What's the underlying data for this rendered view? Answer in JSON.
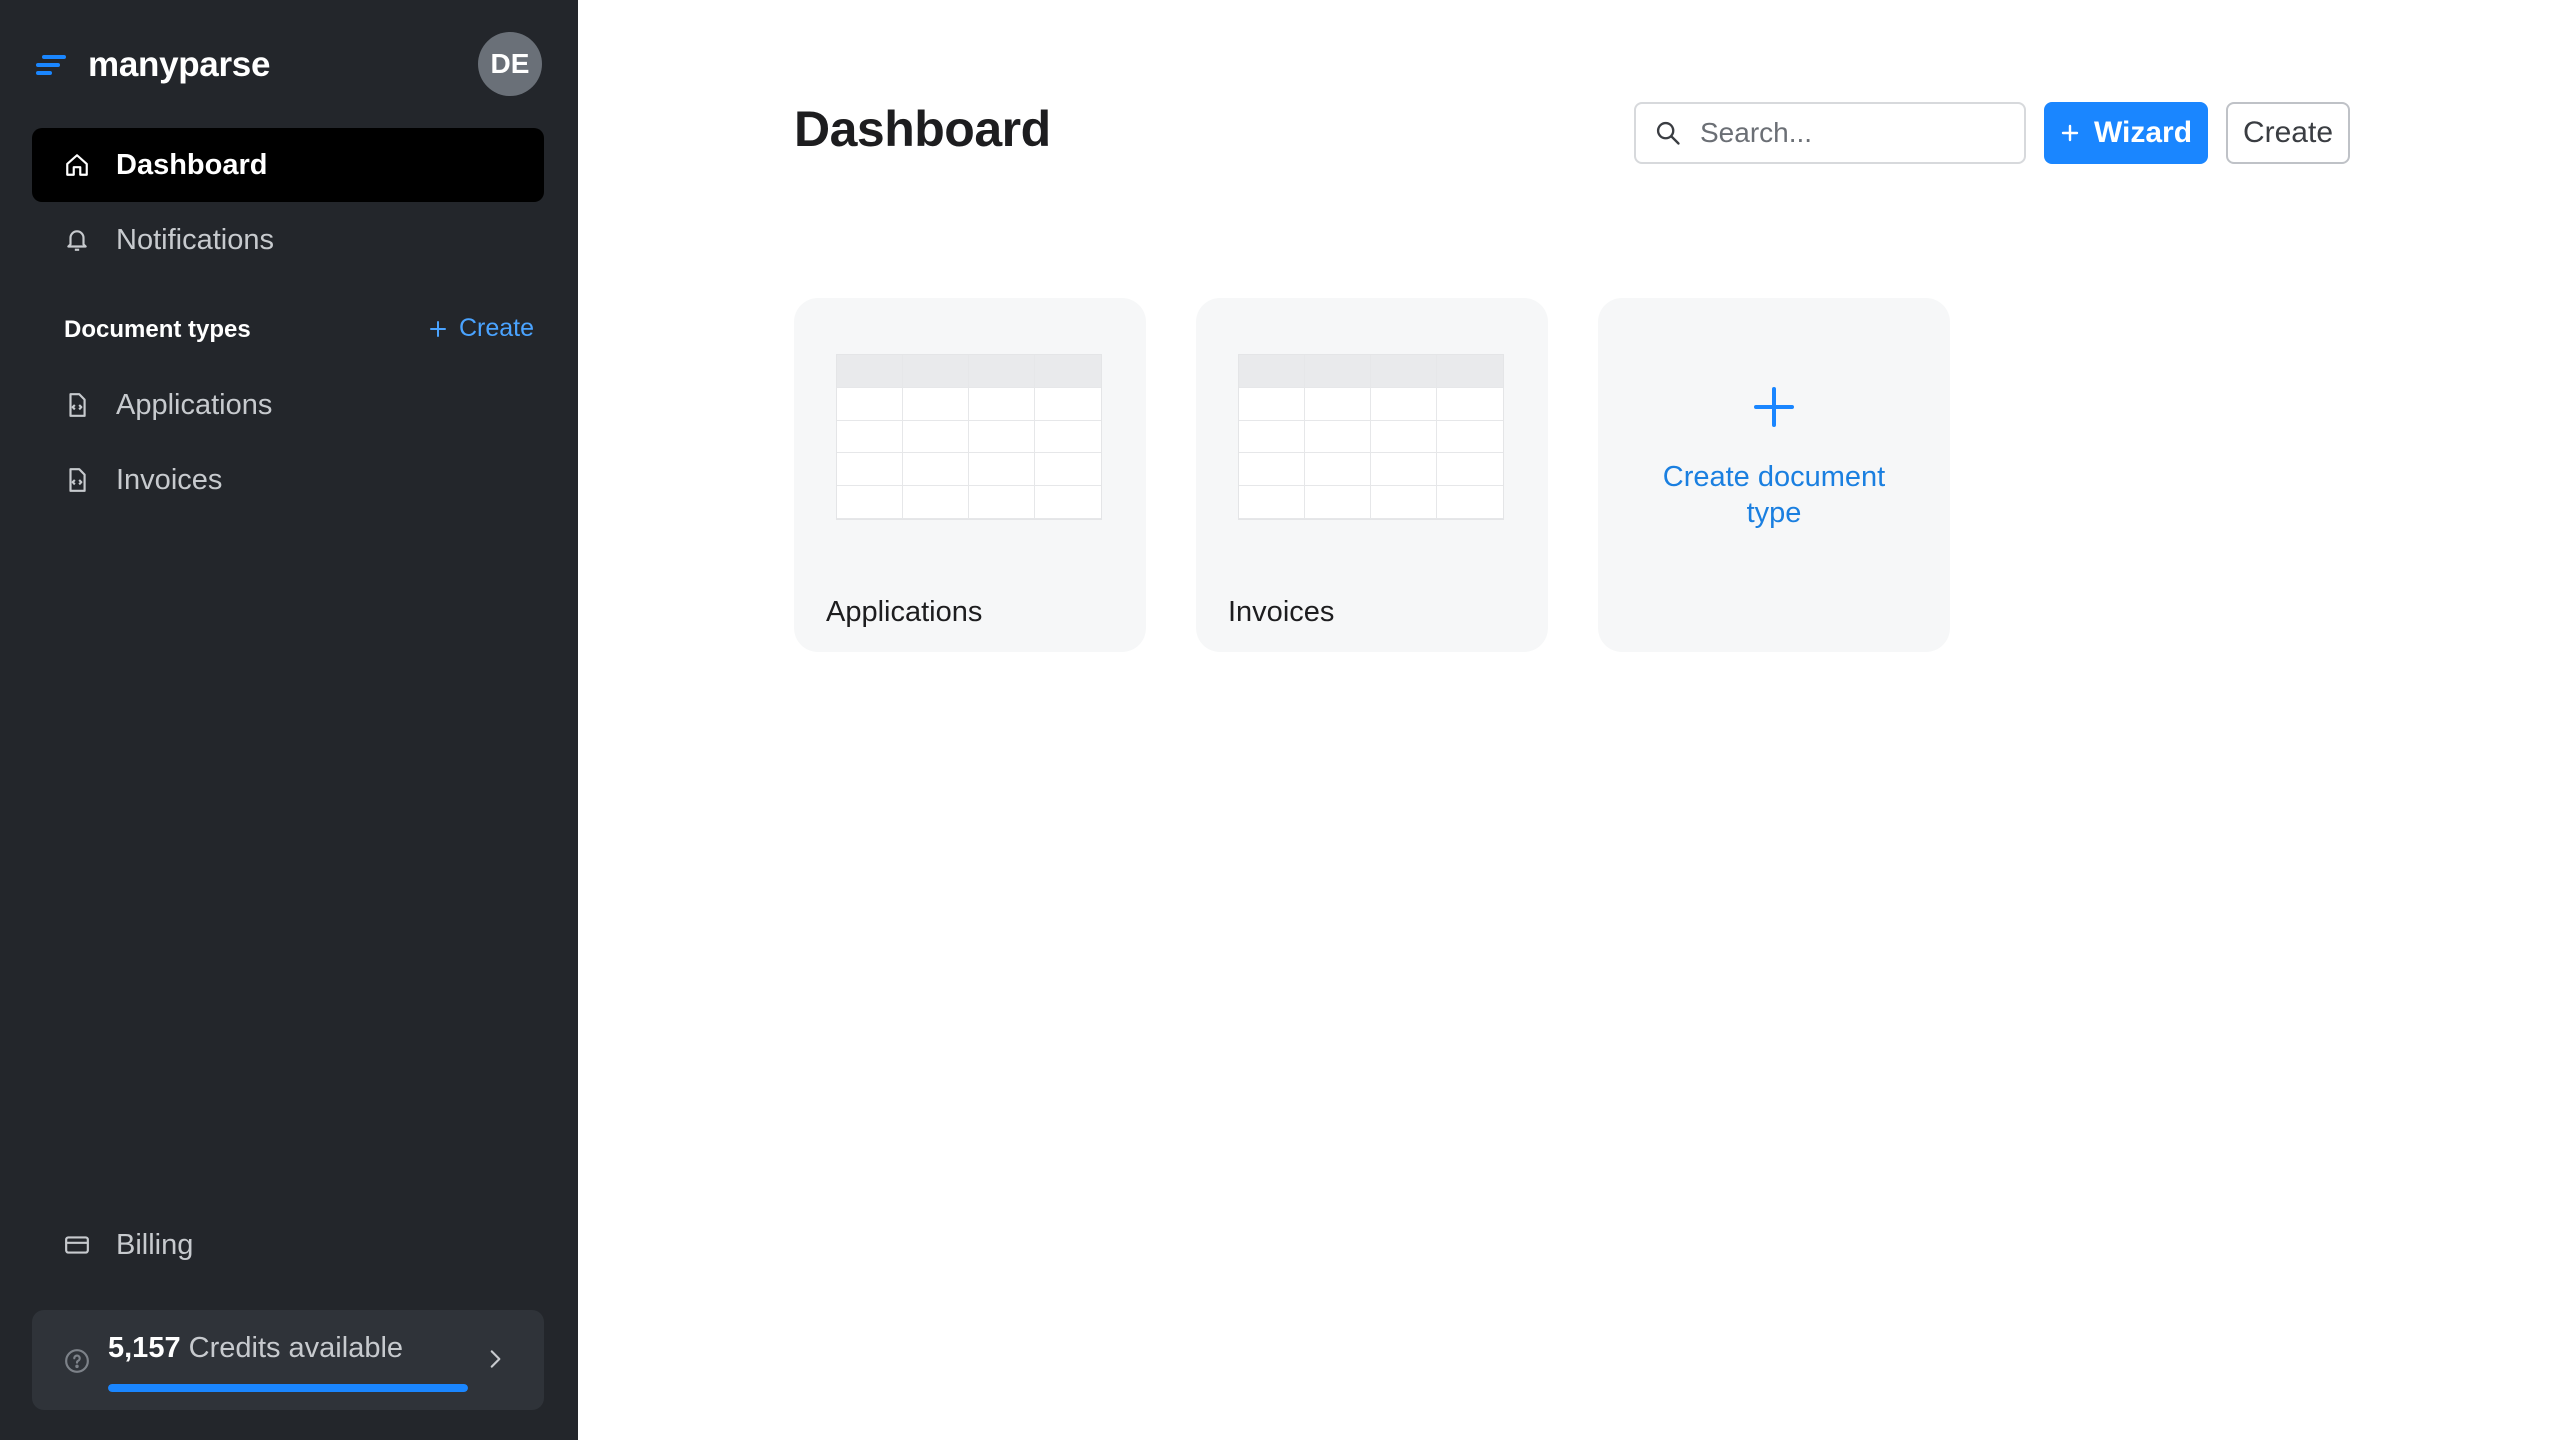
{
  "brand": {
    "name": "manyparse",
    "avatar_initials": "DE",
    "accent": "#1a86ff"
  },
  "sidebar": {
    "nav": [
      {
        "label": "Dashboard",
        "icon": "home-icon",
        "active": true
      },
      {
        "label": "Notifications",
        "icon": "bell-icon",
        "active": false
      }
    ],
    "section": {
      "label": "Document types",
      "create_label": "Create"
    },
    "doc_types": [
      {
        "label": "Applications",
        "icon": "document-icon"
      },
      {
        "label": "Invoices",
        "icon": "document-icon"
      }
    ],
    "billing_label": "Billing",
    "credits": {
      "amount": "5,157",
      "label": "Credits available",
      "progress_fraction": 1.0
    }
  },
  "main": {
    "title": "Dashboard",
    "search": {
      "placeholder": "Search..."
    },
    "wizard_label": "Wizard",
    "create_label": "Create",
    "cards": [
      {
        "label": "Applications"
      },
      {
        "label": "Invoices"
      }
    ],
    "add_card_label": "Create document type"
  }
}
